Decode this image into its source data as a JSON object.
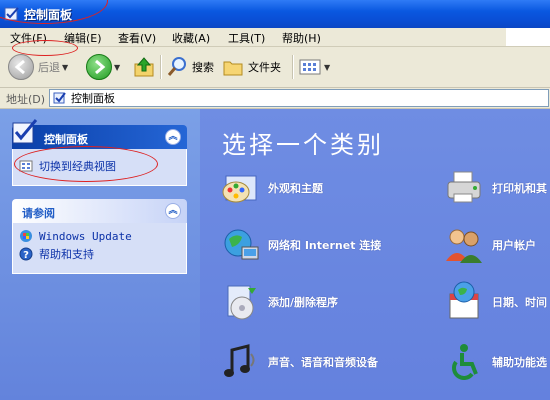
{
  "window": {
    "title": "控制面板"
  },
  "menubar": {
    "items": [
      "文件(F)",
      "编辑(E)",
      "查看(V)",
      "收藏(A)",
      "工具(T)",
      "帮助(H)"
    ]
  },
  "toolbar": {
    "back_label": "后退",
    "search_label": "搜索",
    "folders_label": "文件夹"
  },
  "addressbar": {
    "label": "地址(D)",
    "value": "控制面板"
  },
  "sidebar": {
    "panel1": {
      "title": "控制面板",
      "link": "切换到经典视图"
    },
    "panel2": {
      "title": "请参阅",
      "links": [
        "Windows Update",
        "帮助和支持"
      ]
    }
  },
  "main": {
    "heading": "选择一个类别",
    "categories": [
      {
        "label": "外观和主题",
        "icon": "appearance-icon"
      },
      {
        "label": "打印机和其",
        "icon": "printer-icon"
      },
      {
        "label": "网络和 Internet 连接",
        "icon": "network-icon"
      },
      {
        "label": "用户帐户",
        "icon": "users-icon"
      },
      {
        "label": "添加/删除程序",
        "icon": "add-remove-icon"
      },
      {
        "label": "日期、时间",
        "icon": "calendar-icon"
      },
      {
        "label": "声音、语音和音频设备",
        "icon": "sound-icon"
      },
      {
        "label": "辅助功能选",
        "icon": "accessibility-icon"
      }
    ]
  },
  "colors": {
    "content_bg": "#6f8de3",
    "title_blue": "#0a58e0",
    "link_blue": "#0c32a8"
  }
}
